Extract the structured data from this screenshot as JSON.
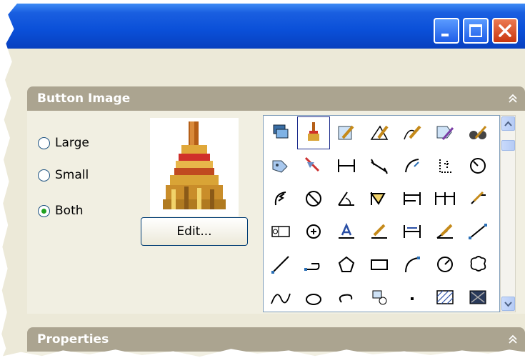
{
  "window": {
    "controls": {
      "minimize_icon": "minimize-icon",
      "maximize_icon": "maximize-icon",
      "close_icon": "close-icon"
    }
  },
  "button_image": {
    "title": "Button Image",
    "size_options": [
      {
        "label": "Large",
        "selected": false
      },
      {
        "label": "Small",
        "selected": false
      },
      {
        "label": "Both",
        "selected": true
      }
    ],
    "edit_label": "Edit...",
    "preview_icon": "broom-icon",
    "icons": [
      [
        "layers-icon",
        "broom-icon",
        "pencil-edit-icon",
        "angle-pencil-icon",
        "curve-pencil-icon",
        "tag-pencil-icon",
        "binoculars-icon"
      ],
      [
        "tag-icon",
        "pointer-icon",
        "dim-linear-icon",
        "dim-aligned-icon",
        "dim-arc-icon",
        "dim-ordinate-icon",
        "dim-radius-icon"
      ],
      [
        "dim-jogged-icon",
        "dim-diameter-icon",
        "dim-angular-icon",
        "quick-dim-icon",
        "dim-baseline-icon",
        "dim-continue-icon",
        "quick-leader-icon"
      ],
      [
        "tolerance-icon",
        "center-mark-icon",
        "dim-edit-icon",
        "dim-text-edit-icon",
        "dim-update-icon",
        "dim-override-icon",
        "line-icon"
      ],
      [
        "ray-icon",
        "polyline-icon",
        "polygon-icon",
        "rectangle-icon",
        "arc-icon",
        "circle-icon",
        "revcloud-icon"
      ],
      [
        "spline-icon",
        "ellipse-icon",
        "ellipse-arc-icon",
        "insert-block-icon",
        "point-icon",
        "hatch-icon",
        "gradient-icon"
      ]
    ],
    "selected_icon": "broom-icon"
  },
  "properties": {
    "title": "Properties"
  },
  "colors": {
    "titlebar": "#0a4fd8",
    "group_header": "#aba490",
    "panel_bg": "#ece9d8",
    "radio_check": "#21a121"
  }
}
